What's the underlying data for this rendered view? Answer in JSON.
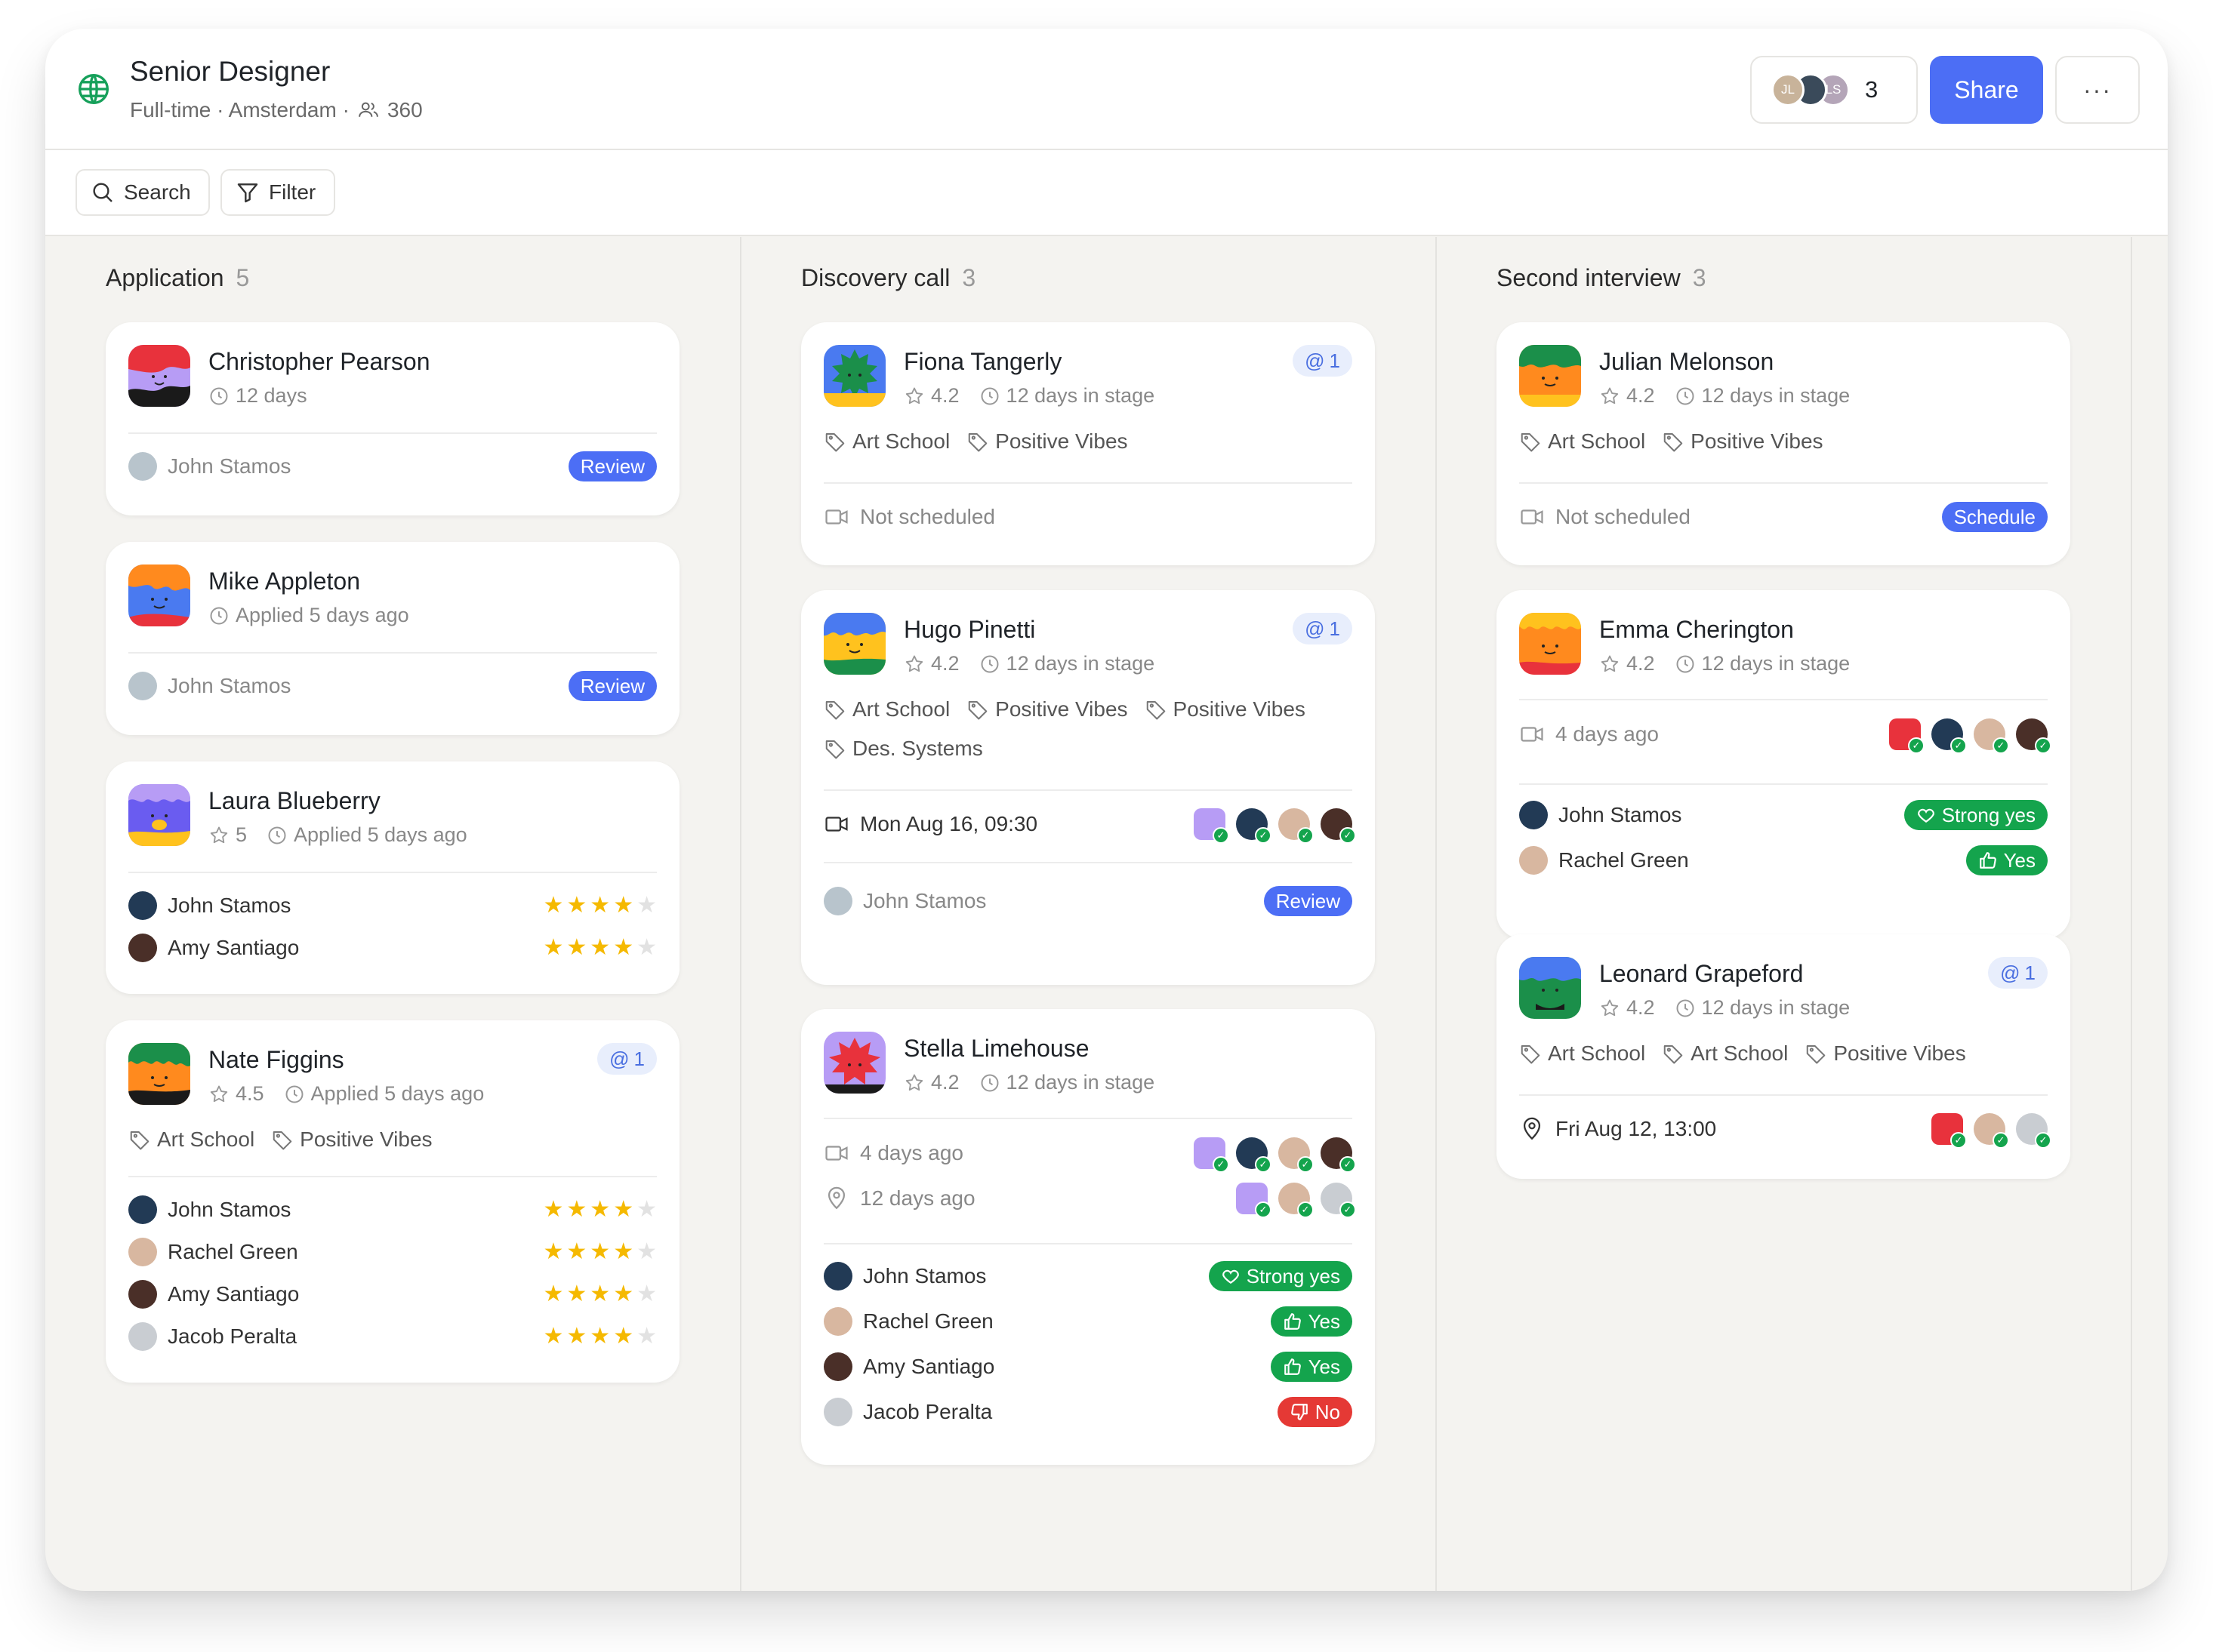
{
  "header": {
    "title": "Senior Designer",
    "meta_text": "Full-time · Amsterdam ·",
    "applicant_count": "360",
    "collaborators": [
      {
        "initials": "JL",
        "color": "#c8b39a"
      },
      {
        "initials": "",
        "color": "#3a4a5a"
      },
      {
        "initials": "LS",
        "color": "#b4a5b8"
      }
    ],
    "collaborator_count": "3",
    "share_label": "Share",
    "more_label": "···"
  },
  "toolbar": {
    "search_label": "Search",
    "filter_label": "Filter"
  },
  "columns": [
    {
      "title": "Application",
      "count": "5"
    },
    {
      "title": "Discovery call",
      "count": "3"
    },
    {
      "title": "Second interview",
      "count": "3"
    }
  ],
  "cards": {
    "christopher": {
      "name": "Christopher Pearson",
      "meta": "12 days",
      "reviewer": "John Stamos",
      "action": "Review"
    },
    "mike": {
      "name": "Mike Appleton",
      "meta": "Applied 5 days ago",
      "reviewer": "John Stamos",
      "action": "Review"
    },
    "laura": {
      "name": "Laura Blueberry",
      "rating": "5",
      "meta": "Applied 5 days ago",
      "reviews": [
        {
          "name": "John Stamos",
          "stars": 4
        },
        {
          "name": "Amy Santiago",
          "stars": 4
        }
      ]
    },
    "nate": {
      "name": "Nate Figgins",
      "mentions": "1",
      "rating": "4.5",
      "meta": "Applied 5 days ago",
      "tags": [
        "Art School",
        "Positive Vibes"
      ],
      "reviews": [
        {
          "name": "John Stamos",
          "stars": 4
        },
        {
          "name": "Rachel Green",
          "stars": 4
        },
        {
          "name": "Amy Santiago",
          "stars": 4
        },
        {
          "name": "Jacob Peralta",
          "stars": 4
        }
      ]
    },
    "fiona": {
      "name": "Fiona Tangerly",
      "mentions": "1",
      "rating": "4.2",
      "meta": "12 days in stage",
      "tags": [
        "Art School",
        "Positive Vibes"
      ],
      "schedule": "Not scheduled"
    },
    "hugo": {
      "name": "Hugo Pinetti",
      "mentions": "1",
      "rating": "4.2",
      "meta": "12 days in stage",
      "tags": [
        "Art School",
        "Positive Vibes",
        "Positive Vibes",
        "Des. Systems"
      ],
      "schedule": "Mon Aug 16, 09:30",
      "reviewer": "John Stamos",
      "action": "Review"
    },
    "stella": {
      "name": "Stella Limehouse",
      "rating": "4.2",
      "meta": "12 days in stage",
      "event1": "4 days ago",
      "event2": "12 days ago",
      "votes": [
        {
          "name": "John Stamos",
          "vote": "Strong yes"
        },
        {
          "name": "Rachel Green",
          "vote": "Yes"
        },
        {
          "name": "Amy Santiago",
          "vote": "Yes"
        },
        {
          "name": "Jacob Peralta",
          "vote": "No"
        }
      ]
    },
    "julian": {
      "name": "Julian Melonson",
      "rating": "4.2",
      "meta": "12 days in stage",
      "tags": [
        "Art School",
        "Positive Vibes"
      ],
      "schedule": "Not scheduled",
      "action": "Schedule"
    },
    "emma": {
      "name": "Emma Cherington",
      "rating": "4.2",
      "meta": "12 days in stage",
      "event1": "4 days ago",
      "votes": [
        {
          "name": "John Stamos",
          "vote": "Strong yes"
        },
        {
          "name": "Rachel Green",
          "vote": "Yes"
        }
      ]
    },
    "leonard": {
      "name": "Leonard Grapeford",
      "mentions": "1",
      "rating": "4.2",
      "meta": "12 days in stage",
      "tags": [
        "Art School",
        "Art School",
        "Positive Vibes"
      ],
      "schedule": "Fri Aug 12, 13:00"
    }
  },
  "colors": {
    "accent": "#4c6ef5",
    "positive": "#14a44d",
    "negative": "#e53935",
    "star": "#f5b900"
  }
}
